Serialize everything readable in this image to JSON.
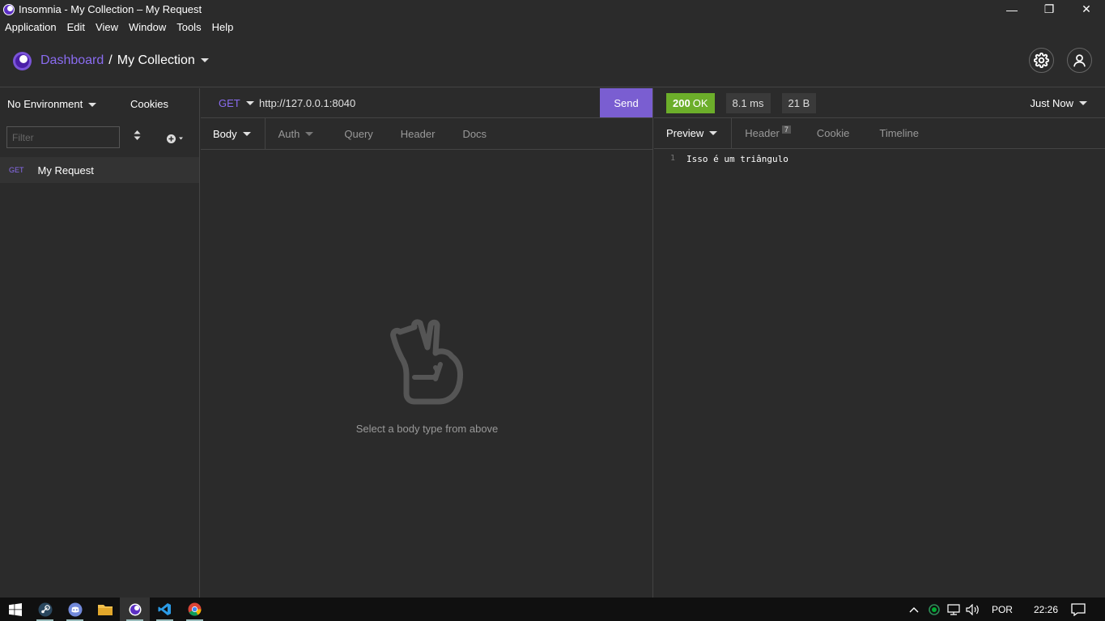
{
  "window": {
    "title": "Insomnia - My Collection – My Request",
    "min_glyph": "—",
    "max_glyph": "❐",
    "close_glyph": "✕"
  },
  "menu": [
    "Application",
    "Edit",
    "View",
    "Window",
    "Tools",
    "Help"
  ],
  "header": {
    "dashboard": "Dashboard",
    "separator": "/",
    "collection": "My Collection"
  },
  "sidebar": {
    "environment": "No Environment",
    "cookies": "Cookies",
    "filter_placeholder": "Filter",
    "requests": [
      {
        "method": "GET",
        "name": "My Request"
      }
    ]
  },
  "request": {
    "method": "GET",
    "url": "http://127.0.0.1:8040",
    "send": "Send",
    "tabs": [
      "Body",
      "Auth",
      "Query",
      "Header",
      "Docs"
    ],
    "empty_text": "Select a body type from above"
  },
  "response": {
    "status_code": "200",
    "status_text": "OK",
    "time": "8.1 ms",
    "size": "21 B",
    "timestamp": "Just Now",
    "tabs": [
      "Preview",
      "Header",
      "Cookie",
      "Timeline"
    ],
    "header_count": "7",
    "lines": [
      {
        "num": "1",
        "text": "Isso é um triângulo"
      }
    ]
  },
  "taskbar": {
    "language": "POR",
    "time": "22:26"
  },
  "colors": {
    "accent": "#7a5ed1",
    "success": "#6cae2a",
    "background": "#2b2b2b"
  }
}
